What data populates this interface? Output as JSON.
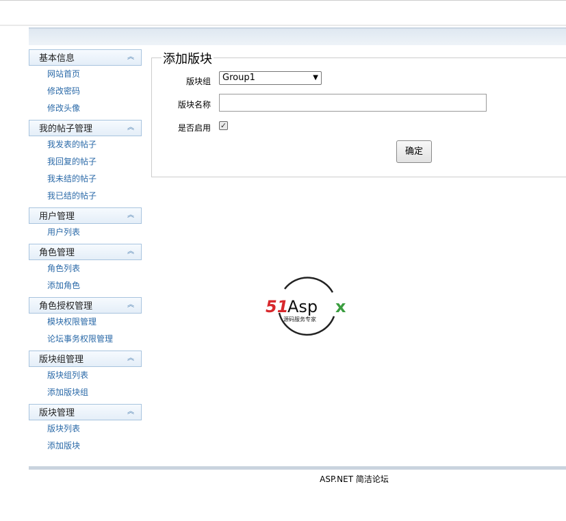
{
  "sidebar": {
    "groups": [
      {
        "title": "基本信息",
        "items": [
          "网站首页",
          "修改密码",
          "修改头像"
        ]
      },
      {
        "title": "我的帖子管理",
        "items": [
          "我发表的帖子",
          "我回复的帖子",
          "我未结的帖子",
          "我已结的帖子"
        ]
      },
      {
        "title": "用户管理",
        "items": [
          "用户列表"
        ]
      },
      {
        "title": "角色管理",
        "items": [
          "角色列表",
          "添加角色"
        ]
      },
      {
        "title": "角色授权管理",
        "items": [
          "模块权限管理",
          "论坛事务权限管理"
        ]
      },
      {
        "title": "版块组管理",
        "items": [
          "版块组列表",
          "添加版块组"
        ]
      },
      {
        "title": "版块管理",
        "items": [
          "版块列表",
          "添加版块"
        ]
      }
    ]
  },
  "form": {
    "legend": "添加版块",
    "group_label": "版块组",
    "group_value": "Group1",
    "name_label": "版块名称",
    "name_value": "",
    "enabled_label": "是否启用",
    "enabled": true,
    "submit_label": "确定"
  },
  "logo": {
    "brand": "51Aspx",
    "tagline": "源码服务专家"
  },
  "footer": {
    "text": "ASP.NET 简洁论坛"
  },
  "colors": {
    "link": "#2b6aa8",
    "sidebar_border": "#a7c3de",
    "logo_red": "#d8282c",
    "logo_green": "#3a9d3f"
  }
}
